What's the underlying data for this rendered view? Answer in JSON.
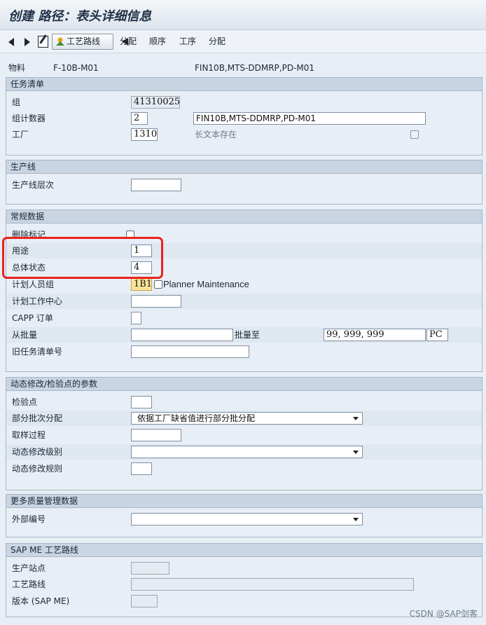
{
  "window": {
    "title": "创建 路径：表头详细信息"
  },
  "toolbar": {
    "route_button": "工艺路线",
    "items": [
      "分配",
      "顺序",
      "工序",
      "分配"
    ]
  },
  "header": {
    "material_label": "物料",
    "material_value": "F-10B-M01",
    "material_desc": "FIN10B,MTS-DDMRP,PD-M01"
  },
  "task_list": {
    "title": "任务清单",
    "group_label": "组",
    "group_value": "41310025",
    "counter_label": "组计数器",
    "counter_value": "2",
    "description_value": "FIN10B,MTS-DDMRP,PD-M01",
    "plant_label": "工厂",
    "plant_value": "1310",
    "long_text_label": "长文本存在"
  },
  "production_line": {
    "title": "生产线",
    "level_label": "生产线层次",
    "level_value": ""
  },
  "general": {
    "title": "常规数据",
    "deletion_label": "删除标记",
    "usage_label": "用途",
    "usage_value": "1",
    "status_label": "总体状态",
    "status_value": "4",
    "planner_label": "计划人员组",
    "planner_value": "1B1",
    "planner_text": "Planner Maintenance",
    "work_center_label": "计划工作中心",
    "work_center_value": "",
    "capp_label": "CAPP 订单",
    "capp_value": "",
    "from_lot_label": "从批量",
    "from_lot_value": "",
    "to_lot_label": "批量至",
    "to_lot_value": "99, 999, 999",
    "unit_value": "PC",
    "old_task_label": "旧任务清单号",
    "old_task_value": ""
  },
  "dynamic": {
    "title": "动态修改/检验点的参数",
    "inspection_point_label": "检验点",
    "inspection_point_value": "",
    "partial_lot_label": "部分批次分配",
    "partial_lot_value": "依据工厂缺省值进行部分批分配",
    "sampling_label": "取样过程",
    "sampling_value": "",
    "dyn_level_label": "动态修改级别",
    "dyn_level_value": "",
    "dyn_rule_label": "动态修改规则",
    "dyn_rule_value": ""
  },
  "more_qm": {
    "title": "更多质量管理数据",
    "ext_number_label": "外部编号",
    "ext_number_value": ""
  },
  "sap_me": {
    "title": "SAP ME 工艺路线",
    "station_label": "生产站点",
    "routing_label": "工艺路线",
    "version_label": "版本 (SAP ME)"
  },
  "watermark": "CSDN @SAP剑客",
  "colors": {
    "highlight_box": "#e8231e",
    "section_header": "#c9d5e3",
    "background": "#e8eef5"
  }
}
